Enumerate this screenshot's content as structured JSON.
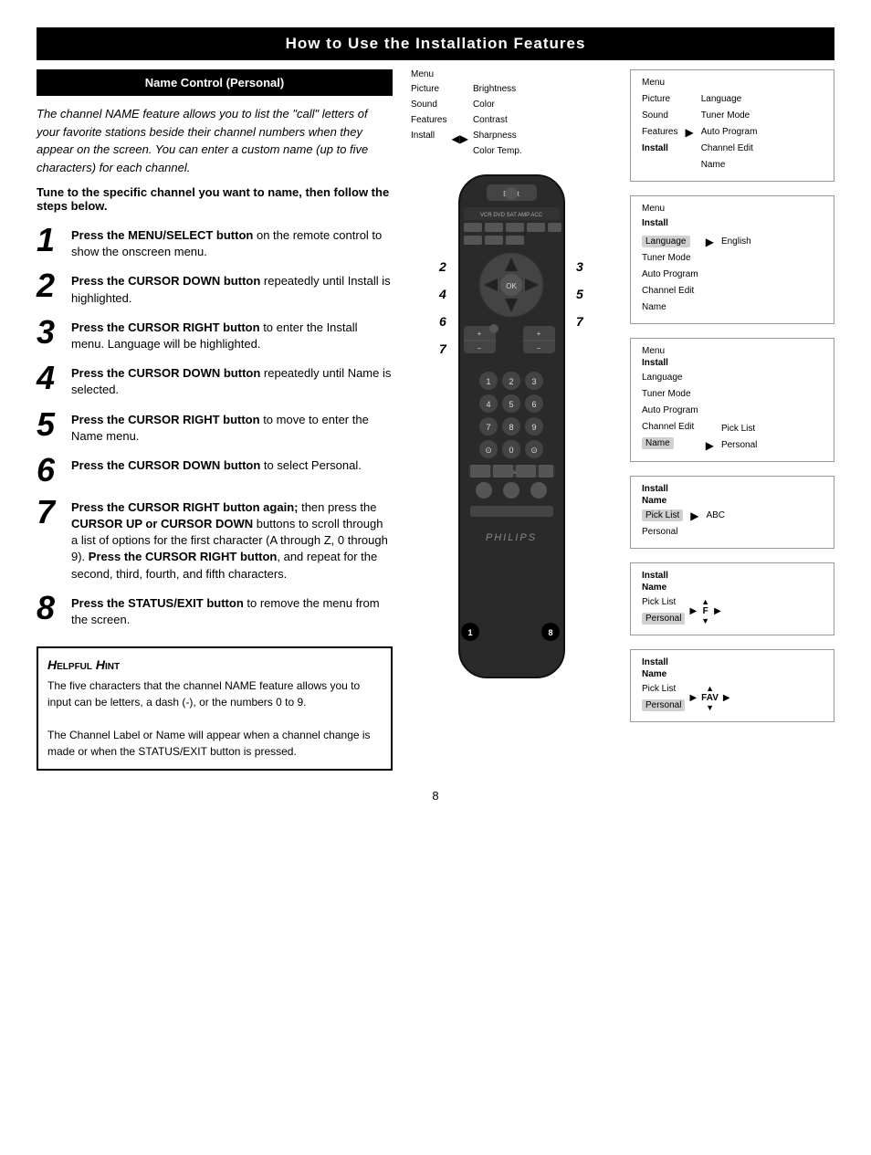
{
  "header": {
    "title": "How to Use the Installation Features"
  },
  "section": {
    "title": "Name Control (Personal)",
    "intro": "The channel NAME feature allows you to list the \"call\" letters of your favorite stations beside their channel numbers when they appear on the screen. You can enter a custom name (up to five characters) for each channel.",
    "tune_instruction": "Tune to the specific channel you want to name, then follow the steps below."
  },
  "steps": [
    {
      "number": "1",
      "text": "Press the MENU/SELECT button on the remote control to show the onscreen menu."
    },
    {
      "number": "2",
      "text": "Press the CURSOR DOWN button repeatedly until Install is highlighted."
    },
    {
      "number": "3",
      "text": "Press the CURSOR RIGHT button to enter the Install menu. Language will be highlighted."
    },
    {
      "number": "4",
      "text": "Press the CURSOR DOWN button repeatedly until Name is selected."
    },
    {
      "number": "5",
      "text": "Press the CURSOR RIGHT button to move to enter the Name menu."
    },
    {
      "number": "6",
      "text": "Press the CURSOR DOWN button to select Personal."
    },
    {
      "number": "7",
      "text": "Press the CURSOR RIGHT button again; then press the CURSOR UP or CURSOR DOWN buttons to scroll through a list of options for the first character (A through Z, 0 through 9). Press the CURSOR RIGHT button, and repeat for the second, third, fourth, and fifth characters."
    },
    {
      "number": "8",
      "text": "Press the STATUS/EXIT button to remove the menu from the screen."
    }
  ],
  "hint": {
    "title": "Helpful Hint",
    "text": "The five characters that the channel NAME feature allows you to input can be letters, a dash (-), or the numbers 0 to 9.\nThe Channel Label or Name will appear when a channel change is made or when the STATUS/EXIT button is pressed."
  },
  "screens": [
    {
      "id": "screen1",
      "title": "Menu",
      "left_items": [
        "Picture",
        "Sound",
        "Features",
        "Install"
      ],
      "right_items": [
        "Brightness",
        "Color",
        "Contrast",
        "Sharpness",
        "Color Temp."
      ],
      "highlighted": "Install",
      "arrow_after": null
    },
    {
      "id": "screen2",
      "title": "Menu",
      "left_items": [
        "Picture",
        "Sound",
        "Features",
        "Install"
      ],
      "right_items": [
        "Language",
        "Tuner Mode",
        "Auto Program",
        "Channel Edit",
        "Name"
      ],
      "highlighted": "Install",
      "arrow_after": "Install"
    },
    {
      "id": "screen3",
      "title": "Menu Install",
      "sub_title": "Language",
      "left_items": [
        "Language",
        "Tuner Mode",
        "Auto Program",
        "Channel Edit",
        "Name"
      ],
      "right_items": [
        "English"
      ],
      "highlighted": "Language",
      "arrow_after": "Language"
    },
    {
      "id": "screen4",
      "title": "Menu Install",
      "left_items": [
        "Language",
        "Tuner Mode",
        "Auto Program",
        "Channel Edit",
        "Name"
      ],
      "right_items": [
        "Pick List",
        "Personal"
      ],
      "highlighted": "Name",
      "arrow_after": "Name"
    },
    {
      "id": "screen5",
      "title": "Install Name",
      "left_items": [
        "Pick List",
        "Personal"
      ],
      "right_items": [
        "ABC"
      ],
      "highlighted": "Pick List",
      "arrow_after": "Pick List"
    },
    {
      "id": "screen6",
      "title": "Install Name",
      "left_items": [
        "Pick List",
        "Personal"
      ],
      "right_items": [
        "F"
      ],
      "highlighted": "Personal",
      "arrow_after": "Personal",
      "extra_arrows": true
    },
    {
      "id": "screen7",
      "title": "Install Name",
      "left_items": [
        "Pick List",
        "Personal"
      ],
      "right_items": [
        "FAV"
      ],
      "highlighted": "Personal",
      "arrow_after": "Personal",
      "extra_arrows": true
    }
  ],
  "page_number": "8"
}
